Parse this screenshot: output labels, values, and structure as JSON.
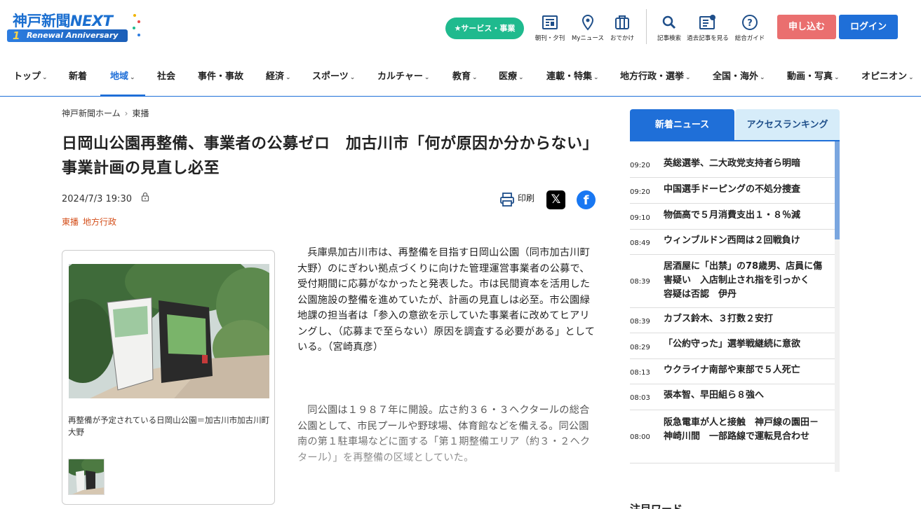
{
  "header": {
    "logo_text": "神戸新聞",
    "logo_next": "NEXT",
    "logo_number": "1",
    "logo_ribbon": "Renewal Anniversary",
    "service_button": "★サービス・事業",
    "icons": [
      {
        "name": "paper-icon",
        "label": "朝刊・夕刊"
      },
      {
        "name": "my-news-icon",
        "label": "Myニュース"
      },
      {
        "name": "outing-icon",
        "label": "おでかけ"
      },
      {
        "name": "search-icon",
        "label": "記事検索"
      },
      {
        "name": "past-articles-icon",
        "label": "過去記事を見る"
      },
      {
        "name": "help-icon",
        "label": "総合ガイド"
      }
    ],
    "apply_button": "申し込む",
    "login_button": "ログイン"
  },
  "nav": [
    {
      "label": "トップ",
      "chevron": true
    },
    {
      "label": "新着",
      "chevron": false
    },
    {
      "label": "地域",
      "chevron": true,
      "active": true
    },
    {
      "label": "社会",
      "chevron": false
    },
    {
      "label": "事件・事故",
      "chevron": false
    },
    {
      "label": "経済",
      "chevron": true
    },
    {
      "label": "スポーツ",
      "chevron": true
    },
    {
      "label": "カルチャー",
      "chevron": true
    },
    {
      "label": "教育",
      "chevron": true
    },
    {
      "label": "医療",
      "chevron": true
    },
    {
      "label": "連載・特集",
      "chevron": true
    },
    {
      "label": "地方行政・選挙",
      "chevron": true
    },
    {
      "label": "全国・海外",
      "chevron": true
    },
    {
      "label": "動画・写真",
      "chevron": true
    },
    {
      "label": "オピニオン",
      "chevron": true
    }
  ],
  "breadcrumb": {
    "home": "神戸新聞ホーム",
    "separator": "›",
    "current": "東播"
  },
  "article": {
    "title": "日岡山公園再整備、事業者の公募ゼロ　加古川市「何が原因か分からない」　事業計画の見直し必至",
    "date": "2024/7/3 19:30",
    "print_label": "印刷",
    "tags": [
      "東播",
      "地方行政"
    ],
    "photo_caption": "再整備が予定されている日岡山公園＝加古川市加古川町大野",
    "paragraph1": "兵庫県加古川市は、再整備を目指す日岡山公園（同市加古川町大野）のにぎわい拠点づくりに向けた管理運営事業者の公募で、受付期間に応募がなかったと発表した。市は民間資本を活用した公園施設の整備を進めていたが、計画の見直しは必至。市公園緑地課の担当者は「参入の意欲を示していた事業者に改めてヒアリングし、（応募まで至らない）原因を調査する必要がある」としている。（宮崎真彦）",
    "paragraph2": "同公園は１９８７年に開設。広さ約３６・３ヘクタールの総合公園として、市民プールや野球場、体育館などを備える。同公園南の第１駐車場などに面する「第１期整備エリア（約３・２ヘクタール）」を再整備の区域としていた。"
  },
  "sidebar": {
    "tab_new": "新着ニュース",
    "tab_ranking": "アクセスランキング",
    "news": [
      {
        "time": "09:20",
        "headline": "英総選挙、二大政党支持者ら明暗"
      },
      {
        "time": "09:20",
        "headline": "中国選手ドーピングの不処分捜査"
      },
      {
        "time": "09:10",
        "headline": "物価高で５月消費支出１・８％減"
      },
      {
        "time": "08:49",
        "headline": "ウィンブルドン西岡は２回戦負け"
      },
      {
        "time": "08:39",
        "headline": "居酒屋に「出禁」の78歳男、店員に傷害疑い　入店制止され指を引っかく　容疑は否認　伊丹"
      },
      {
        "time": "08:39",
        "headline": "カブス鈴木、３打数２安打"
      },
      {
        "time": "08:29",
        "headline": "「公約守った」選挙戦継続に意欲"
      },
      {
        "time": "08:13",
        "headline": "ウクライナ南部や東部で５人死亡"
      },
      {
        "time": "08:03",
        "headline": "張本智、早田組ら８強へ"
      },
      {
        "time": "08:00",
        "headline": "阪急電車が人と接触　神戸線の園田－神崎川間　一部路線で運転見合わせ"
      }
    ],
    "attention_title": "注目ワード"
  },
  "colors": {
    "brand_blue": "#1f6fd8",
    "service_green": "#1fba8e",
    "apply_red": "#ea6f6f",
    "tag_orange": "#d4501c"
  }
}
